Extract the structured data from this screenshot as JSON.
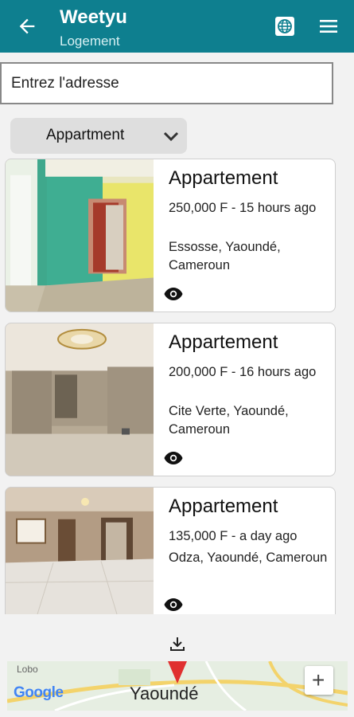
{
  "appbar": {
    "title": "Weetyu",
    "subtitle": "Logement",
    "back_icon": "arrow-left-icon",
    "language_icon": "globe-icon",
    "menu_icon": "hamburger-menu-icon"
  },
  "search": {
    "placeholder": "Entrez l'adresse",
    "value": ""
  },
  "filter": {
    "selected": "Appartment"
  },
  "listings": [
    {
      "title": "Appartement",
      "price_time": "250,000 F - 15 hours ago",
      "location": "Essosse, Yaoundé, Cameroun"
    },
    {
      "title": "Appartement",
      "price_time": "200,000 F - 16 hours ago",
      "location": "Cite Verte, Yaoundé, Cameroun"
    },
    {
      "title": "Appartement",
      "price_time": "135,000 F - a day ago",
      "location": "Odza, Yaoundé, Cameroun"
    }
  ],
  "map": {
    "label_small": "Lobo",
    "city": "Yaoundé",
    "brand": "Google",
    "zoom_in": "+"
  },
  "colors": {
    "appbar": "#0e7f8f",
    "background": "#f2f2f2",
    "pin": "#e03030"
  }
}
